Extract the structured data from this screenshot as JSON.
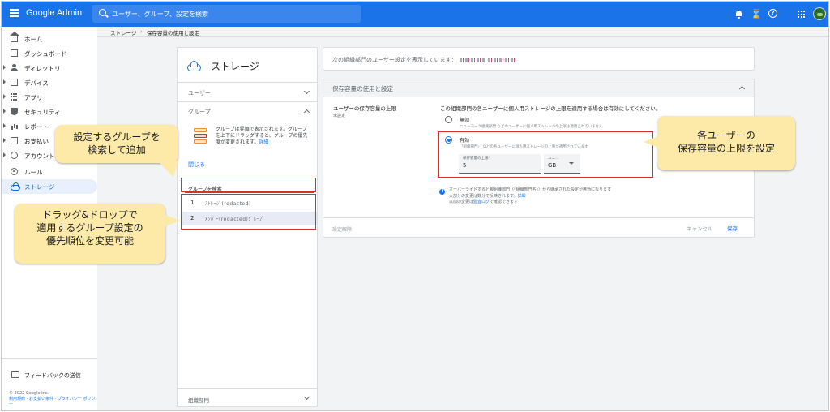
{
  "topbar": {
    "app_name": "Google Admin",
    "search_placeholder": "ユーザー、グループ、設定を検索",
    "hourglass_glyph": "⌛",
    "help_glyph": "?"
  },
  "nav": {
    "items": [
      {
        "label": "ホーム",
        "icon": "home-icon"
      },
      {
        "label": "ダッシュボード",
        "icon": "dashboard-icon"
      },
      {
        "label": "ディレクトリ",
        "icon": "user-icon"
      },
      {
        "label": "デバイス",
        "icon": "devices-icon"
      },
      {
        "label": "アプリ",
        "icon": "apps-icon"
      },
      {
        "label": "セキュリティ",
        "icon": "shield-icon"
      },
      {
        "label": "レポート",
        "icon": "bar-chart-icon"
      },
      {
        "label": "お支払い",
        "icon": "billing-icon"
      },
      {
        "label": "アカウント",
        "icon": "at-sign-icon"
      },
      {
        "label": "ルール",
        "icon": "rule-icon"
      },
      {
        "label": "ストレージ",
        "icon": "cloud-icon"
      }
    ],
    "feedback_label": "フィードバックの送信",
    "copyright": "© 2022 Google Inc.",
    "links": [
      "利用規約",
      "お支払い条件",
      "プライバシー ポリシー"
    ],
    "link_sep": " - "
  },
  "breadcrumb": {
    "root": "ストレージ",
    "sep": "›",
    "current": "保存容量の使用と設定"
  },
  "left_panel": {
    "title": "ストレージ",
    "sections": {
      "users": "ユーザー",
      "groups": "グループ",
      "org_units": "組織部門"
    },
    "group_description": "グループは昇順で表示されます。グループを上下にドラッグすると、グループの優先度が変更されます。",
    "group_description_link": "詳細",
    "close_link": "閉じる",
    "group_search_label": "グループを検索",
    "group_rows": [
      {
        "num": "1",
        "name": "ｽﾄﾚｰｼﾞ(redacted)"
      },
      {
        "num": "2",
        "name": "ﾒﾝﾊﾞｰ(redacted)ｸﾞﾙｰﾌﾟ"
      }
    ]
  },
  "org_bar": {
    "text": "次の組織部門のユーザー設定を表示しています："
  },
  "settings": {
    "header": "保存容量の使用と設定",
    "title": "ユーザーの保存容量の上限",
    "subtitle": "未設定",
    "description": "この組織部門の各ユーザーに個人用ストレージの上限を適用する場合は有効にしてください。",
    "option_off_label": "無効",
    "option_off_sub": "ニューヨーク組織部門 などのユーザーに個人用ストレージの上限は適用されていません",
    "option_on_label": "有効",
    "option_on_sub": "「組織部門」 などの各ユーザーに個人用ストレージの上限が適用されています",
    "limit_label": "保存容量の上限*",
    "limit_value": "5",
    "unit_label": "ユニ...",
    "unit_value": "GB",
    "info_line1": "オーバーライドすると親組織部門（「組織部門名」）から継承された設定が無効になります",
    "info_line2": "大部分の変更は数分で反映されます。",
    "info_link": "詳細",
    "info_line3_pre": "以前の変更は",
    "info_line3_link": "監査ログ",
    "info_line3_post": "で確認できます",
    "footer_status": "設定解除",
    "cancel_label": "キャンセル",
    "save_label": "保存"
  },
  "annotations": {
    "callout_search": [
      "設定するグループを",
      "検索して追加"
    ],
    "callout_drag": [
      "ドラッグ&ドロップで",
      "適用するグループ設定の",
      "優先順位を変更可能"
    ],
    "callout_limit": [
      "各ユーザーの",
      "保存容量の上限を設定"
    ],
    "box_color": "#d93025",
    "callout_color": "#fde9a8"
  },
  "colors": {
    "brand_bar": "#1a73e8",
    "active_nav_bg": "#e8f0fe"
  }
}
